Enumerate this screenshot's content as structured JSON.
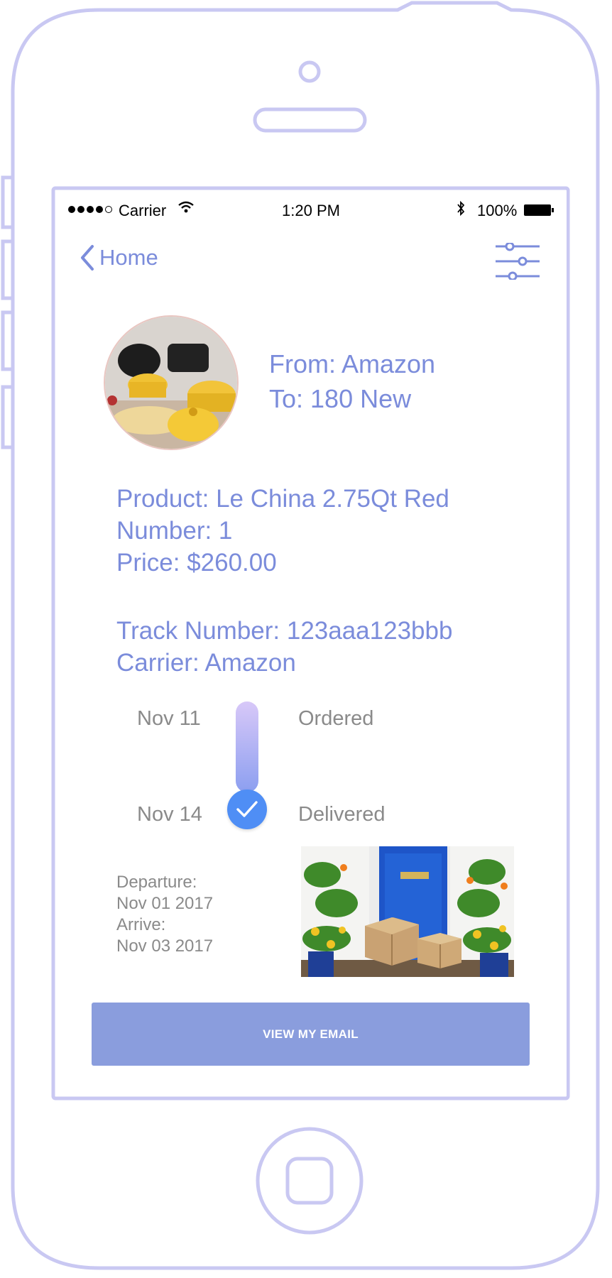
{
  "status_bar": {
    "carrier": "Carrier",
    "time": "1:20 PM",
    "battery": "100%"
  },
  "nav": {
    "back_label": "Home",
    "back_icon": "chevron-left-icon",
    "filter_icon": "sliders-icon"
  },
  "shipment": {
    "from": "From: Amazon",
    "to": "To: 180 New"
  },
  "product": {
    "name": "Product: Le China 2.75Qt Red",
    "number": "Number: 1",
    "price": "Price: $260.00"
  },
  "tracking": {
    "track_number": "Track Number: 123aaa123bbb",
    "carrier": "Carrier: Amazon"
  },
  "timeline": [
    {
      "date": "Nov 11",
      "status": "Ordered"
    },
    {
      "date": "Nov 14",
      "status": "Delivered"
    }
  ],
  "dates": {
    "departure_label": "Departure:",
    "departure_date": "Nov 01 2017",
    "arrive_label": "Arrive:",
    "arrive_date": "Nov 03 2017"
  },
  "action": {
    "email_button": "VIEW MY EMAIL"
  },
  "colors": {
    "accent": "#7b8cdb",
    "button": "#8a9ddd",
    "check": "#4f8ef5",
    "frame": "#c9c8f2"
  }
}
